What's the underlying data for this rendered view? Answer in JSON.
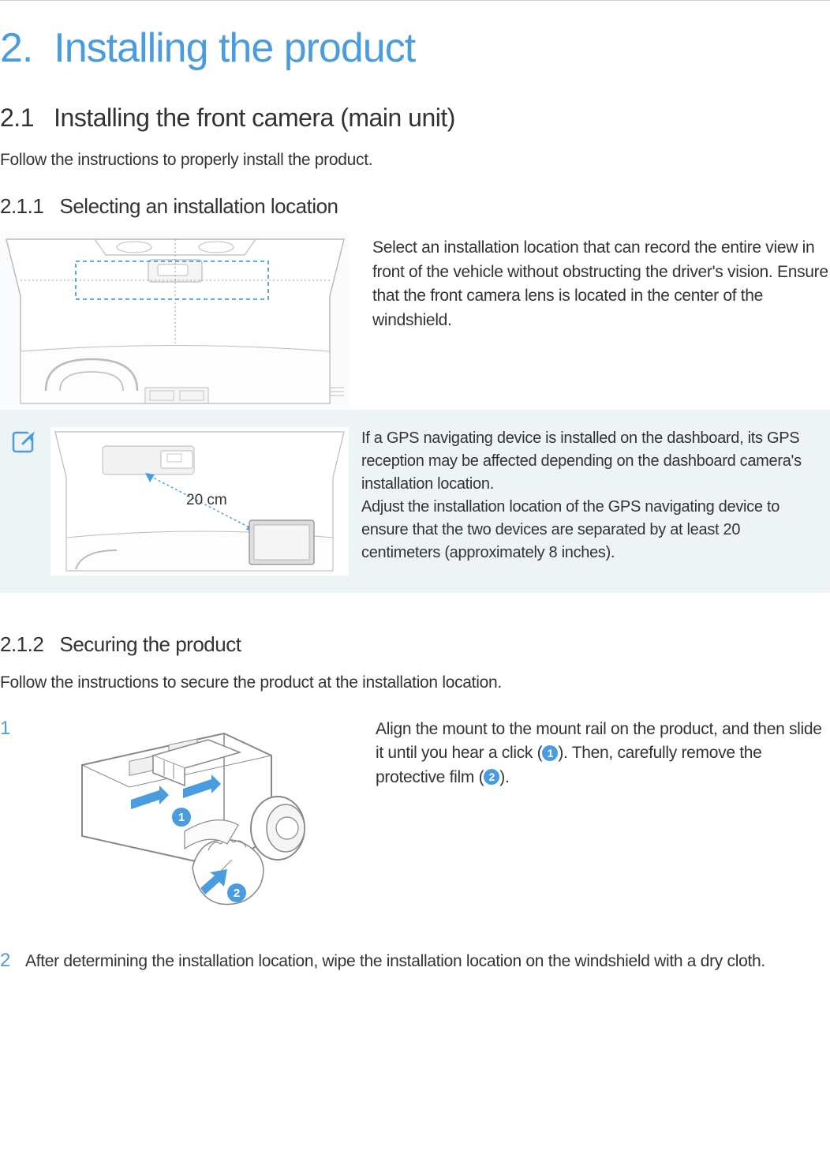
{
  "h1_num": "2.",
  "h1_text": "Installing the product",
  "h2_num": "2.1",
  "h2_text": "Installing the front camera (main unit)",
  "intro_211": "Follow the instructions to properly install the product.",
  "h3_211_num": "2.1.1",
  "h3_211_text": "Selecting an installation location",
  "para_211": "Select an installation location that can record the entire view in front of the vehicle without obstructing the driver's vision. Ensure that the front camera lens is located in the center of the windshield.",
  "note_gps_label": "20 cm",
  "note_text_1": "If a GPS navigating device is installed on the dashboard, its GPS reception may be affected depending on the dashboard camera's installation location.",
  "note_text_2": "Adjust the installation location of the GPS navigating device to ensure that the two devices are separated by at least 20 centimeters (approximately 8 inches).",
  "h3_212_num": "2.1.2",
  "h3_212_text": "Securing the product",
  "intro_212": "Follow the instructions to secure the product at the installation location.",
  "step1_num": "1",
  "step1_text_a": "Align the mount to the mount rail on the product, and then slide it until you hear a click (",
  "step1_badge1": "1",
  "step1_text_b": "). Then, carefully remove the protective film (",
  "step1_badge2": "2",
  "step1_text_c": ").",
  "step2_num": "2",
  "step2_text": "After determining the installation location, wipe the installation location on the windshield with a dry cloth."
}
